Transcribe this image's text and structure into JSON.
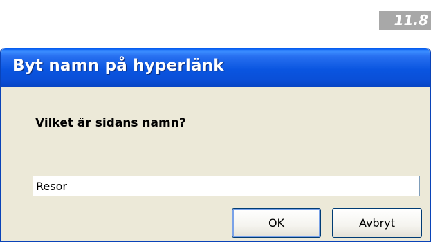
{
  "badge": {
    "text": "11.8"
  },
  "dialog": {
    "title": "Byt namn på hyperlänk",
    "prompt": "Vilket är sidans namn?",
    "name_value": "Resor",
    "buttons": {
      "ok_label": "OK",
      "cancel_label": "Avbryt"
    }
  },
  "colors": {
    "titlebar": "#0a55e0",
    "dialog_background": "#ece9d8",
    "badge_background": "#a8a8a8",
    "button_border": "#003c74"
  }
}
